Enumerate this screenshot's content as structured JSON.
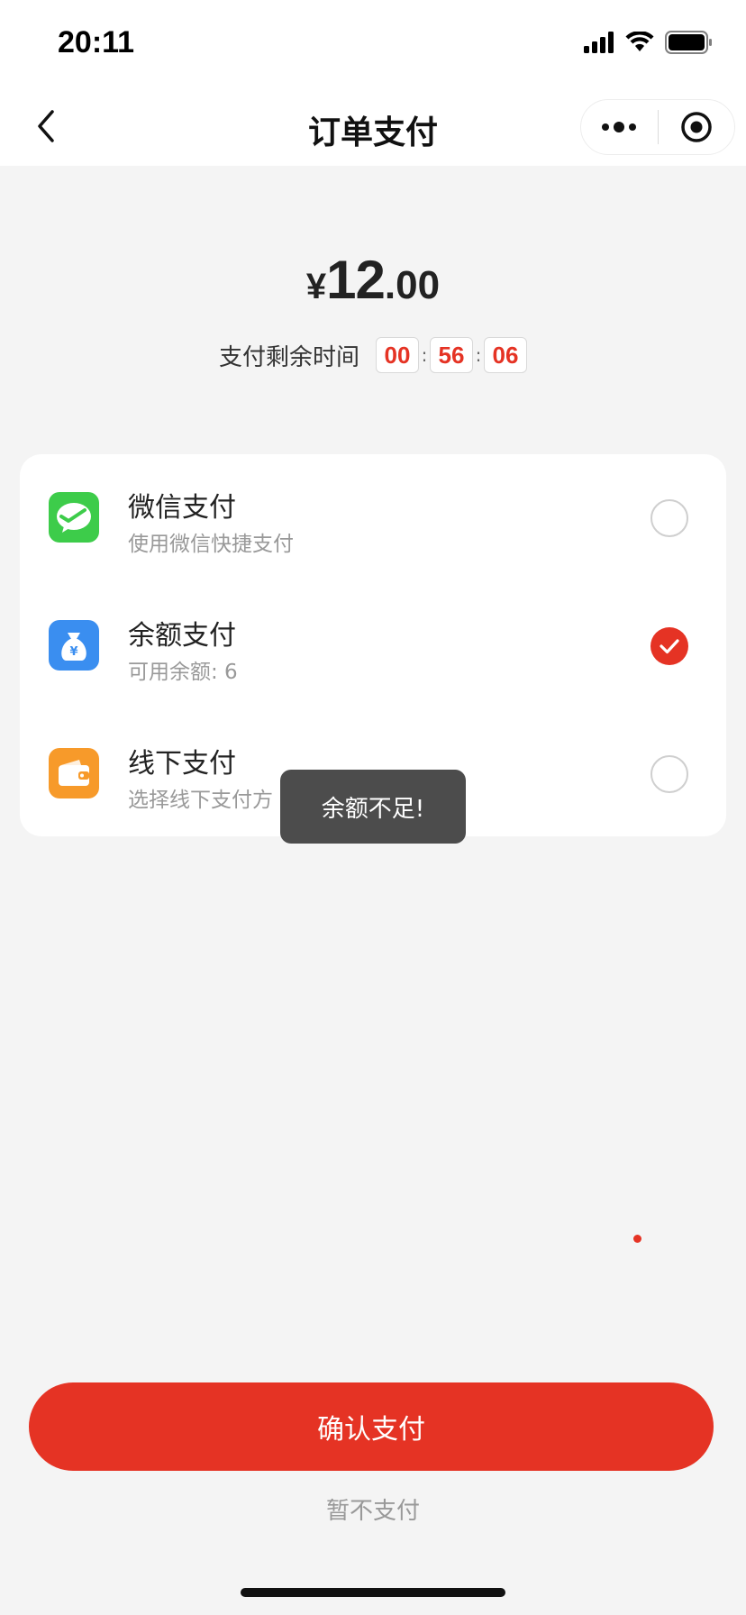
{
  "status_bar": {
    "time": "20:11"
  },
  "nav": {
    "title": "订单支付"
  },
  "amount": {
    "currency": "¥",
    "integer": "12",
    "decimal": ".00"
  },
  "countdown": {
    "label": "支付剩余时间",
    "hours": "00",
    "minutes": "56",
    "seconds": "06",
    "separator": ":"
  },
  "payment_methods": [
    {
      "title": "微信支付",
      "subtitle": "使用微信快捷支付",
      "icon": "wechat-pay-icon",
      "selected": false
    },
    {
      "title": "余额支付",
      "subtitle": "可用余额: 6",
      "icon": "balance-moneybag-icon",
      "selected": true
    },
    {
      "title": "线下支付",
      "subtitle": "选择线下支付方",
      "icon": "wallet-icon",
      "selected": false
    }
  ],
  "toast": {
    "message": "余额不足!"
  },
  "actions": {
    "confirm_label": "确认支付",
    "cancel_label": "暂不支付"
  },
  "colors": {
    "accent": "#e53324",
    "wechat_green": "#3dcc4a",
    "balance_blue": "#3a8ef0",
    "offline_orange": "#f79a2a",
    "background": "#f4f4f4"
  }
}
